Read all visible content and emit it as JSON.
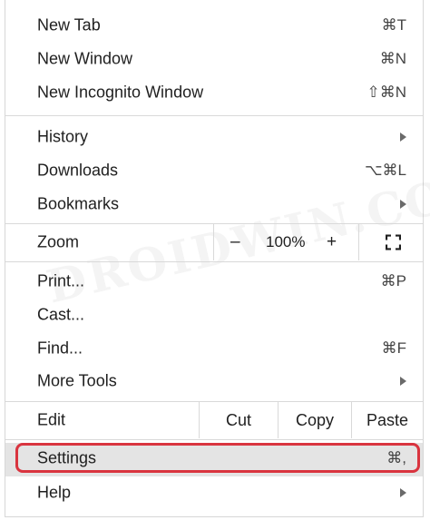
{
  "menu": {
    "items": [
      {
        "label": "New Tab",
        "shortcut": "⌘T"
      },
      {
        "label": "New Window",
        "shortcut": "⌘N"
      },
      {
        "label": "New Incognito Window",
        "shortcut": "⇧⌘N"
      },
      {
        "label": "History",
        "submenu": true
      },
      {
        "label": "Downloads",
        "shortcut": "⌥⌘L"
      },
      {
        "label": "Bookmarks",
        "submenu": true
      },
      {
        "label": "Print...",
        "shortcut": "⌘P"
      },
      {
        "label": "Cast..."
      },
      {
        "label": "Find...",
        "shortcut": "⌘F"
      },
      {
        "label": "More Tools",
        "submenu": true
      },
      {
        "label": "Settings",
        "shortcut": "⌘,",
        "highlighted": true
      },
      {
        "label": "Help",
        "submenu": true
      }
    ],
    "zoom": {
      "label": "Zoom",
      "minus": "–",
      "level": "100%",
      "plus": "+",
      "fullscreen_icon": "fullscreen-icon"
    },
    "edit": {
      "label": "Edit",
      "cut": "Cut",
      "copy": "Copy",
      "paste": "Paste"
    }
  },
  "watermark": "DROIDWIN.COM",
  "colors": {
    "highlight_outline": "#d9343f",
    "highlight_background": "#e4e4e4"
  }
}
